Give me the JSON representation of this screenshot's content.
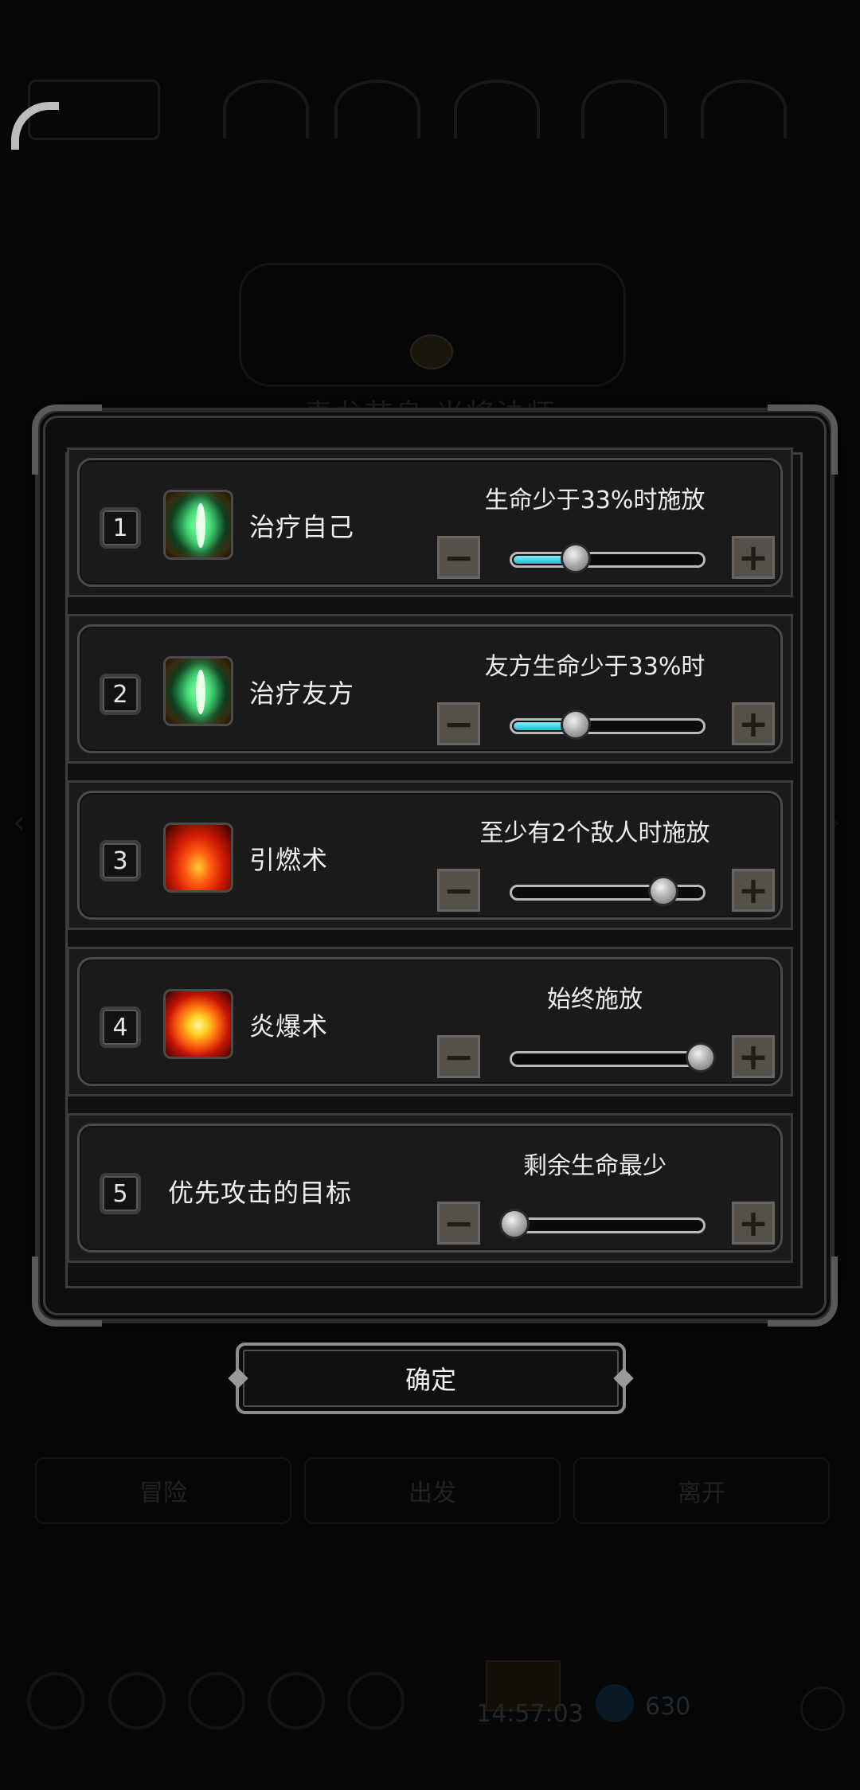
{
  "background": {
    "title": "毒龙节息 当将法师",
    "nav": [
      "冒险",
      "出发",
      "离开"
    ],
    "time": "14:57:03",
    "gold": "630"
  },
  "dialog": {
    "rows": [
      {
        "number": "1",
        "skill": "治疗自己",
        "icon": "heal-icon",
        "condition": "生命少于33%时施放",
        "slider_fraction": 0.33,
        "minus_label": "−",
        "plus_label": "+"
      },
      {
        "number": "2",
        "skill": "治疗友方",
        "icon": "heal-icon",
        "condition": "友方生命少于33%时",
        "slider_fraction": 0.33,
        "minus_label": "−",
        "plus_label": "+"
      },
      {
        "number": "3",
        "skill": "引燃术",
        "icon": "fire-icon",
        "condition": "至少有2个敌人时施放",
        "slider_fraction": 0.8,
        "minus_label": "−",
        "plus_label": "+"
      },
      {
        "number": "4",
        "skill": "炎爆术",
        "icon": "explosion-icon",
        "condition": "始终施放",
        "slider_fraction": 1.0,
        "minus_label": "−",
        "plus_label": "+"
      },
      {
        "number": "5",
        "skill": "优先攻击的目标",
        "icon": "",
        "condition": "剩余生命最少",
        "slider_fraction": 0.0,
        "minus_label": "−",
        "plus_label": "+"
      }
    ],
    "confirm_label": "确定"
  },
  "colors": {
    "slider_fill": "#21b8cc",
    "panel_bg": "#1a1a1a",
    "button_bg": "#55504a"
  }
}
